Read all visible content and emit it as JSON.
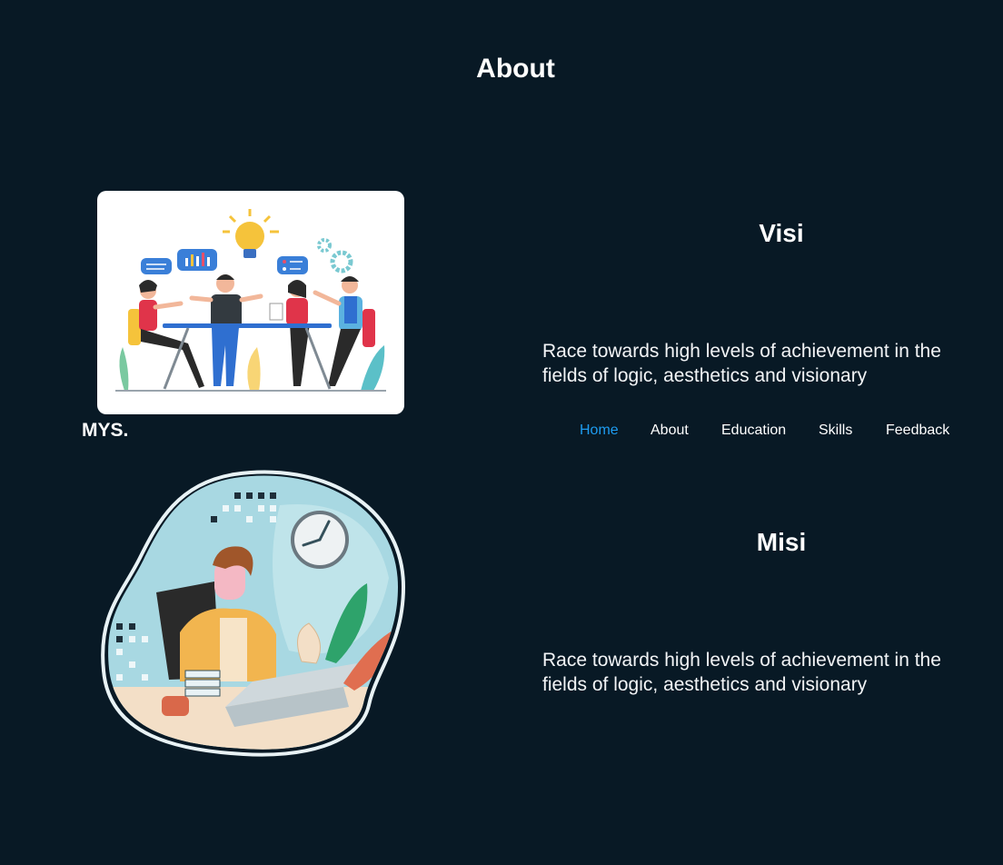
{
  "about": {
    "title": "About"
  },
  "vision": {
    "heading": "Visi",
    "text": "Race towards high levels of achievement in the fields of logic, aesthetics and visionary",
    "illustration": "team-meeting-illustration"
  },
  "mission": {
    "heading": "Misi",
    "text": "Race towards high levels of achievement in the fields of logic, aesthetics and visionary",
    "illustration": "person-at-laptop-illustration"
  },
  "navbar": {
    "brand": "MYS.",
    "items": [
      {
        "label": "Home",
        "active": true
      },
      {
        "label": "About",
        "active": false
      },
      {
        "label": "Education",
        "active": false
      },
      {
        "label": "Skills",
        "active": false
      },
      {
        "label": "Feedback",
        "active": false
      }
    ]
  },
  "colors": {
    "background": "#081925",
    "text": "#ffffff",
    "nav_active": "#1e9cf0"
  }
}
